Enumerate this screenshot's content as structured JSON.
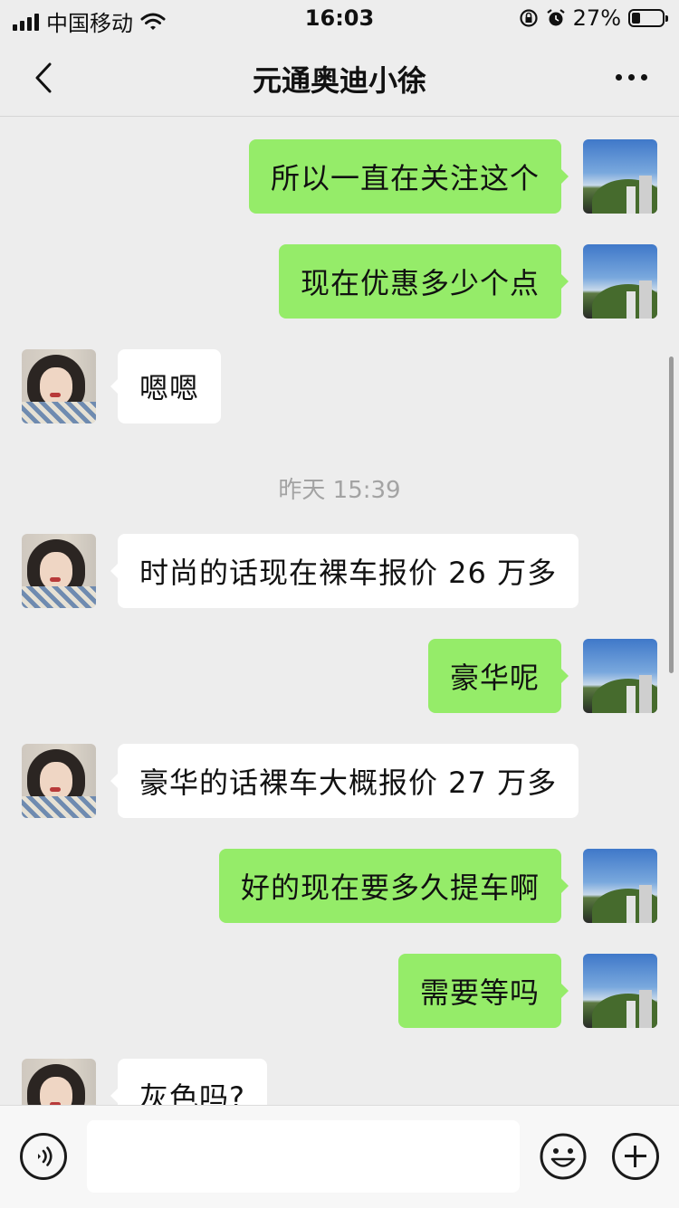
{
  "status_bar": {
    "carrier": "中国移动",
    "time": "16:03",
    "battery": "27%",
    "battery_level": 0.27,
    "icons": [
      "signal-icon",
      "wifi-icon",
      "orientation-lock-icon",
      "alarm-icon",
      "battery-icon"
    ]
  },
  "nav": {
    "title": "元通奥迪小徐",
    "back_icon": "chevron-left-icon",
    "more_icon": "more-icon"
  },
  "messages": [
    {
      "side": "sent",
      "text": "所以一直在关注这个"
    },
    {
      "side": "sent",
      "text": "现在优惠多少个点"
    },
    {
      "side": "recv",
      "text": "嗯嗯"
    },
    {
      "timestamp": "昨天 15:39"
    },
    {
      "side": "recv",
      "text": "时尚的话现在裸车报价 26 万多"
    },
    {
      "side": "sent",
      "text": "豪华呢"
    },
    {
      "side": "recv",
      "text": "豪华的话裸车大概报价 27 万多"
    },
    {
      "side": "sent",
      "text": "好的现在要多久提车啊"
    },
    {
      "side": "sent",
      "text": "需要等吗"
    },
    {
      "side": "recv",
      "text": "灰色吗?"
    }
  ],
  "input_bar": {
    "text_value": "",
    "icons": [
      "voice-icon",
      "emoji-icon",
      "plus-icon"
    ]
  },
  "colors": {
    "background": "#ededed",
    "sent_bubble": "#95ec69",
    "recv_bubble": "#ffffff",
    "timestamp": "#a3a3a3"
  }
}
